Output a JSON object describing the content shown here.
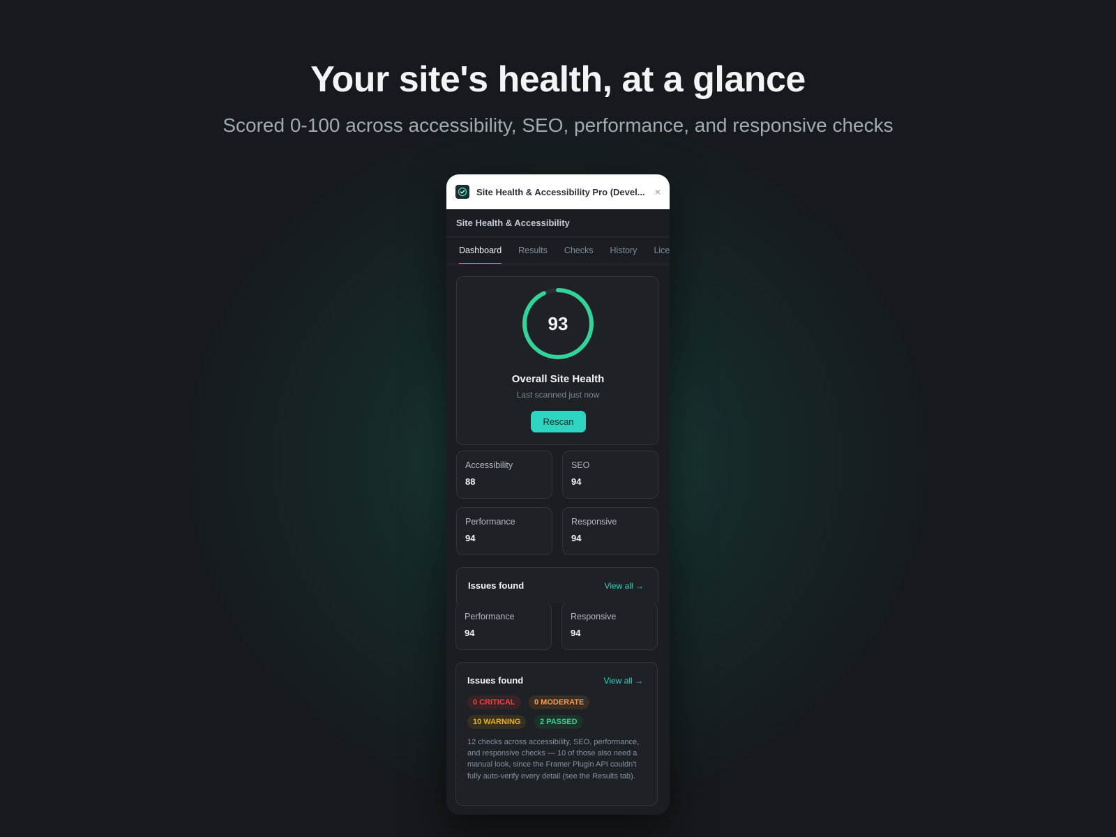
{
  "hero": {
    "title": "Your site's health, at a glance",
    "subtitle": "Scored 0-100 across accessibility, SEO, performance, and responsive checks"
  },
  "window": {
    "title": "Site Health & Accessibility Pro (Devel...",
    "close_icon": "×"
  },
  "app": {
    "header": "Site Health & Accessibility"
  },
  "tabs": [
    {
      "label": "Dashboard",
      "active": true
    },
    {
      "label": "Results"
    },
    {
      "label": "Checks"
    },
    {
      "label": "History"
    },
    {
      "label": "Licen"
    }
  ],
  "overall": {
    "score": "93",
    "score_fraction": 0.93,
    "title": "Overall Site Health",
    "subtitle": "Last scanned just now",
    "rescan_label": "Rescan",
    "ring_color": "#34d399"
  },
  "metrics": {
    "accessibility": {
      "label": "Accessibility",
      "value": "88"
    },
    "seo": {
      "label": "SEO",
      "value": "94"
    },
    "performance": {
      "label": "Performance",
      "value": "94"
    },
    "responsive": {
      "label": "Responsive",
      "value": "94"
    }
  },
  "issues": {
    "title": "Issues found",
    "view_all": "View all →",
    "critical": "0 CRITICAL",
    "moderate": "0 MODERATE",
    "warning": "10 WARNING",
    "passed": "2 PASSED",
    "description": "12 checks across accessibility, SEO, performance, and responsive checks — 10 of those also need a manual look, since the Framer Plugin API couldn't fully auto-verify every detail (see the Results tab)."
  },
  "colors": {
    "accent": "#2dd4bf",
    "critical": "#ef4444",
    "moderate": "#f59e54",
    "warning": "#eab308",
    "passed": "#34d399"
  }
}
